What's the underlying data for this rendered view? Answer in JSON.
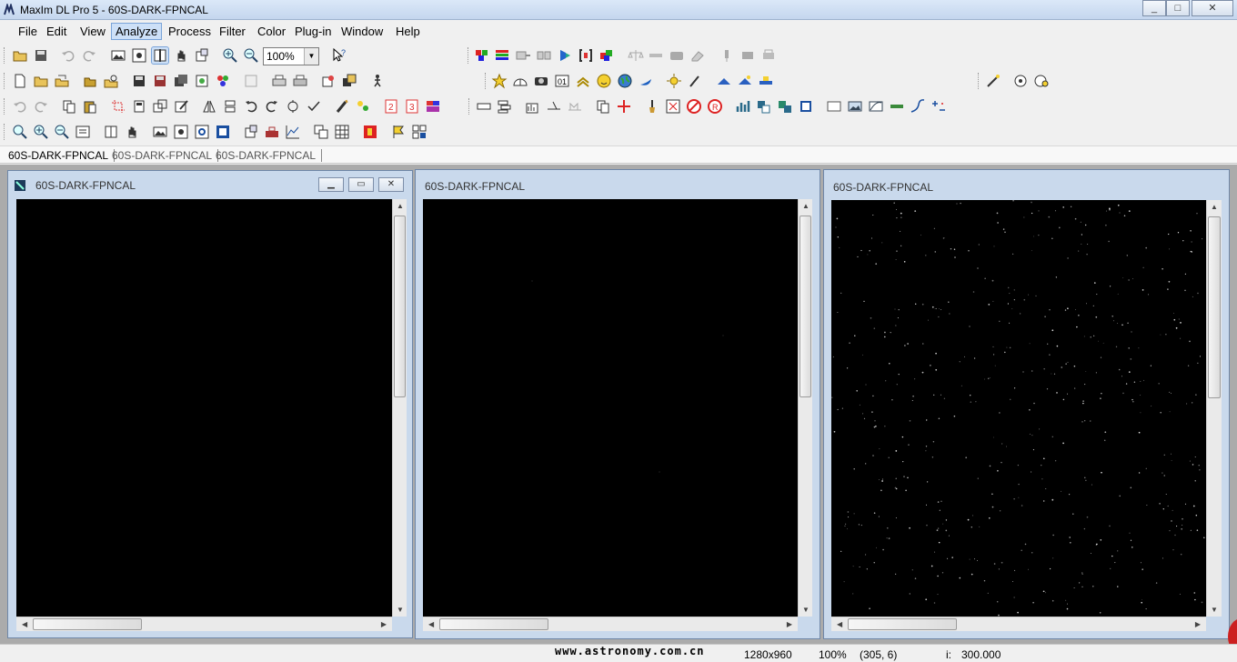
{
  "window": {
    "title": "MaxIm DL Pro 5 - 60S-DARK-FPNCAL",
    "min": "_",
    "max": "□",
    "close": "✕"
  },
  "menu": [
    {
      "label": "File"
    },
    {
      "label": "Edit"
    },
    {
      "label": "View"
    },
    {
      "label": "Analyze"
    },
    {
      "label": "Process"
    },
    {
      "label": "Filter"
    },
    {
      "label": "Color"
    },
    {
      "label": "Plug-in"
    },
    {
      "label": "Window"
    },
    {
      "label": "Help"
    }
  ],
  "zoom": {
    "value": "100%"
  },
  "tabs": [
    {
      "label": "60S-DARK-FPNCAL"
    },
    {
      "label": "60S-DARK-FPNCAL"
    },
    {
      "label": "60S-DARK-FPNCAL"
    }
  ],
  "windows": [
    {
      "title": "60S-DARK-FPNCAL",
      "min": "▁",
      "restore": "▭",
      "close": "✕"
    },
    {
      "title": "60S-DARK-FPNCAL"
    },
    {
      "title": "60S-DARK-FPNCAL"
    }
  ],
  "status": {
    "watermark": "www.astronomy.com.cn",
    "size": "1280x960",
    "zoom": "100%",
    "coords": "(305, 6)",
    "intensity_label": "i:",
    "intensity_value": "300.000"
  },
  "colors": {
    "titlebar": "#c4d6ee",
    "window_frame": "#c9d9ec",
    "workspace": "#ababab",
    "image_bg": "#000000"
  }
}
